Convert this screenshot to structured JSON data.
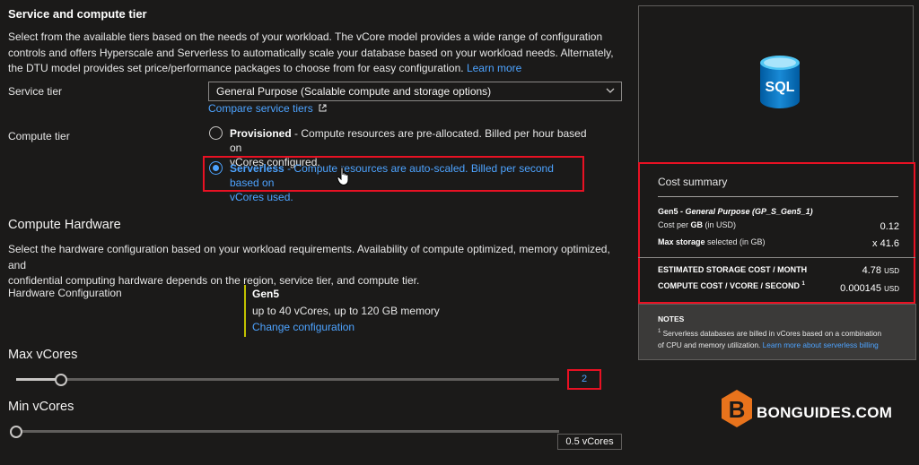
{
  "header": {
    "title": "Service and compute tier",
    "description": "Select from the available tiers based on the needs of your workload. The vCore model provides a wide range of configuration controls and offers Hyperscale and Serverless to automatically scale your database based on your workload needs. Alternately, the DTU model provides set price/performance packages to choose from for easy configuration.",
    "learn_more": "Learn more"
  },
  "service_tier": {
    "label": "Service tier",
    "value": "General Purpose (Scalable compute and storage options)",
    "compare_link": "Compare service tiers"
  },
  "compute_tier": {
    "label": "Compute tier",
    "provisioned_title": "Provisioned",
    "provisioned_desc_1": " - Compute resources are pre-allocated. Billed per hour based on",
    "provisioned_desc_2": "vCores configured.",
    "serverless_title": "Serverless",
    "serverless_desc_1": " - Compute resources are auto-scaled. Billed per second based on",
    "serverless_desc_2": "vCores used.",
    "selected": "Serverless"
  },
  "hardware": {
    "heading": "Compute Hardware",
    "desc_1": "Select the hardware configuration based on your workload requirements. Availability of compute optimized, memory optimized, and",
    "desc_2": "confidential computing hardware depends on the region, service tier, and compute tier.",
    "config_label": "Hardware Configuration",
    "gen": "Gen5",
    "gen_detail": "up to 40 vCores, up to 120 GB memory",
    "change_link": "Change configuration"
  },
  "max_vcores": {
    "label": "Max vCores",
    "value": "2",
    "slider_fraction": 0.083
  },
  "min_vcores": {
    "label": "Min vCores",
    "value": "0.5 vCores",
    "slider_fraction": 0.0
  },
  "cost_summary": {
    "title": "Cost summary",
    "product_gen": "Gen5",
    "product_name": " - General Purpose (GP_S_Gen5_1)",
    "cost_per_gb_label": "Cost per ",
    "cost_per_gb_bold": "GB",
    "cost_per_gb_unit": " (in USD)",
    "cost_per_gb_value": "0.12",
    "max_storage_bold": "Max storage",
    "max_storage_rest": " selected (in GB)",
    "max_storage_value": "x 41.6",
    "est_storage_label": "ESTIMATED STORAGE COST / MONTH",
    "est_storage_value": "4.78",
    "est_storage_unit": "USD",
    "compute_cost_label": "COMPUTE COST / VCORE / SECOND",
    "compute_cost_sup": "1",
    "compute_cost_value": "0.000145",
    "compute_cost_unit": "USD"
  },
  "notes": {
    "title": "NOTES",
    "sup": "1",
    "text_1": " Serverless databases are billed in vCores based on a combination",
    "text_2": "of CPU and memory utilization. ",
    "link": "Learn more about serverless billing"
  },
  "sql_icon_text": "SQL",
  "watermark": {
    "letter": "B",
    "text": "BONGUIDES.COM"
  },
  "colors": {
    "background": "#1b1a19",
    "link": "#4da3ff",
    "highlight_red": "#e81123",
    "hardware_bar": "#c1c100",
    "brand_orange": "#e8731c"
  }
}
